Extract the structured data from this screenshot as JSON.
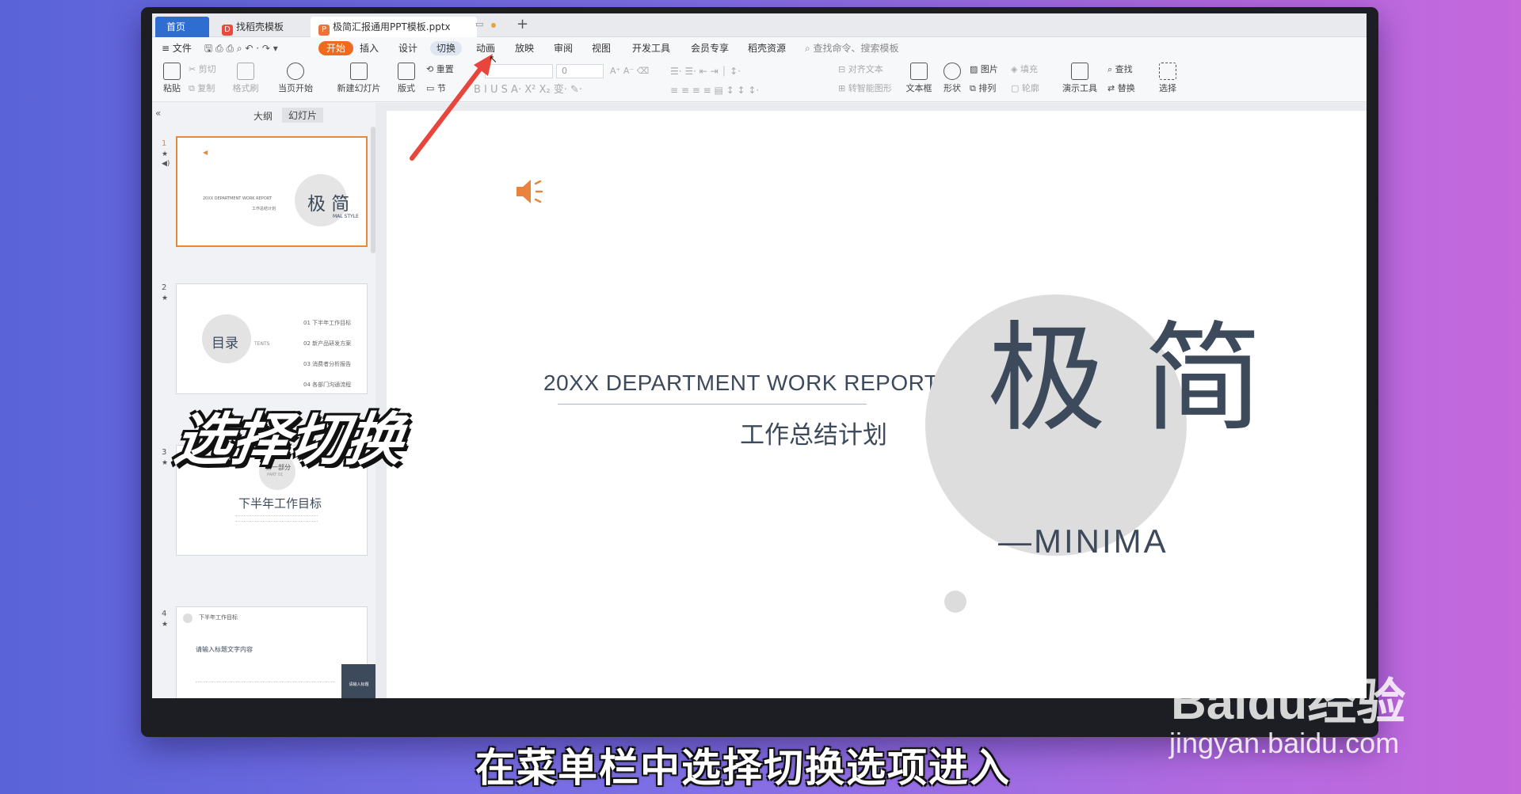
{
  "tabs": {
    "home": "首页",
    "template": "找稻壳模板",
    "file": "极简汇报通用PPT模板.pptx",
    "add": "+"
  },
  "menu": {
    "file": "≡ 文件",
    "items": [
      "开始",
      "插入",
      "设计",
      "切换",
      "动画",
      "放映",
      "审阅",
      "视图",
      "开发工具",
      "会员专享",
      "稻壳资源"
    ],
    "search": "查找命令、搜索模板"
  },
  "ribbon": {
    "paste": "粘贴",
    "cut": "剪切",
    "copy": "复制",
    "format_painter": "格式刷",
    "from_current": "当页开始",
    "new_slide": "新建幻灯片",
    "layout": "版式",
    "reset": "重置",
    "section": "节",
    "font_size": "0",
    "align_text": "对齐文本",
    "smartart": "转智能图形",
    "textbox": "文本框",
    "shape": "形状",
    "picture": "图片",
    "arrange": "排列",
    "fill": "填充",
    "outline": "轮廓",
    "present_tools": "演示工具",
    "find": "查找",
    "replace": "替换",
    "select": "选择"
  },
  "left_pane": {
    "tab_outline": "大纲",
    "tab_slides": "幻灯片",
    "thumbs": [
      {
        "num": "1",
        "en": "20XX DEPARTMENT WORK REPORT",
        "cn": "工作总结计划",
        "big": "极 简",
        "sub": "MAL STYLE"
      },
      {
        "num": "2",
        "circle": "目录",
        "en": "TENTS",
        "items": [
          {
            "n": "01",
            "t": "下半年工作目标"
          },
          {
            "n": "02",
            "t": "新产品研发方案"
          },
          {
            "n": "03",
            "t": "消费者分析报告"
          },
          {
            "n": "04",
            "t": "各部门沟通流程"
          }
        ]
      },
      {
        "num": "3",
        "part": "第一部分",
        "part_en": "PART 01",
        "title": "下半年工作目标"
      },
      {
        "num": "4",
        "head": "下半年工作目标",
        "sub": "请输入标题文字内容",
        "card": "请输入标题"
      }
    ]
  },
  "slide": {
    "title_en": "20XX DEPARTMENT WORK REPORT",
    "title_cn": "工作总结计划",
    "big_chars": "极 简",
    "minimal": "—MINIMA"
  },
  "overlay": {
    "callout": "选择切换",
    "caption": "在菜单栏中选择切换选项进入",
    "watermark_logo": "Baidu经验",
    "watermark_url": "jingyan.baidu.com"
  },
  "colors": {
    "accent_orange": "#f06a1d",
    "slide_circle": "#dddddd",
    "slide_text": "#3c4a5c",
    "arrow": "#e8453c"
  }
}
